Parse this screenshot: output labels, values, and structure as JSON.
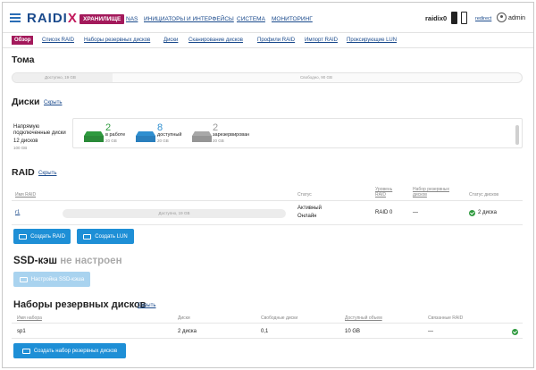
{
  "header": {
    "logo": "RAIDIX",
    "menu": [
      "ХРАНИЛИЩЕ",
      "NAS",
      "ИНИЦИАТОРЫ И ИНТЕРФЕЙСЫ",
      "СИСТЕМА",
      "МОНИТОРИНГ"
    ],
    "device": "raidix0",
    "redirect": "redirect",
    "user": "admin"
  },
  "subnav": [
    "Обзор",
    "Список RAID",
    "Наборы резервных дисков",
    "Диски",
    "Сканирование дисков",
    "Профили RAID",
    "Импорт RAID",
    "Прокси­рующие LUN"
  ],
  "volumes": {
    "title": "Тома",
    "available": "Доступно, 19 GB",
    "free": "Свободно, 90 GB"
  },
  "disks": {
    "title": "Диски",
    "hide": "Скрыть",
    "label1": "Напрямую",
    "label2": "подключенные диски",
    "count_label": "12 дисков",
    "count_gb": "100 GB",
    "groups": [
      {
        "count": "2",
        "label": "в работе",
        "gb": "20 GB",
        "color": "#2e9a3e"
      },
      {
        "count": "8",
        "label": "доступный",
        "gb": "20 GB",
        "color": "#2f8fd0"
      },
      {
        "count": "2",
        "label": "зарезервирован",
        "gb": "20 GB",
        "color": "#9a9a9a"
      }
    ]
  },
  "raid": {
    "title": "RAID",
    "hide": "Скрыть",
    "columns": {
      "name": "Имя RAID",
      "status": "Статус",
      "level_1": "Уровень",
      "level_2": "RAID",
      "spare_1": "Набор резервных",
      "spare_2": "дисков",
      "disk_status": "Статус дисков"
    },
    "row": {
      "name": "r1",
      "capacity": "Доступно, 19 GB",
      "status_1": "Активный",
      "status_2": "Онлайн",
      "level": "RAID 0",
      "spare": "—",
      "disks": "2 диска"
    },
    "btn_create_raid": "Создать RAID",
    "btn_create_lun": "Создать LUN"
  },
  "ssd": {
    "title": "SSD-кэш",
    "state": "не настроен",
    "btn": "Настройка SSD-кэша"
  },
  "spares": {
    "title": "Наборы резервных дисков",
    "hide": "Скрыть",
    "columns": {
      "name": "Имя набора",
      "disks": "Диски",
      "free": "Свободные диски",
      "size": "Доступный объем",
      "linked": "Связанные RAID"
    },
    "row": {
      "name": "sp1",
      "disks": "2 диска",
      "free": "0,1",
      "size": "10 GB",
      "linked": "—"
    },
    "btn_create": "Создать набор резервных дисков"
  }
}
